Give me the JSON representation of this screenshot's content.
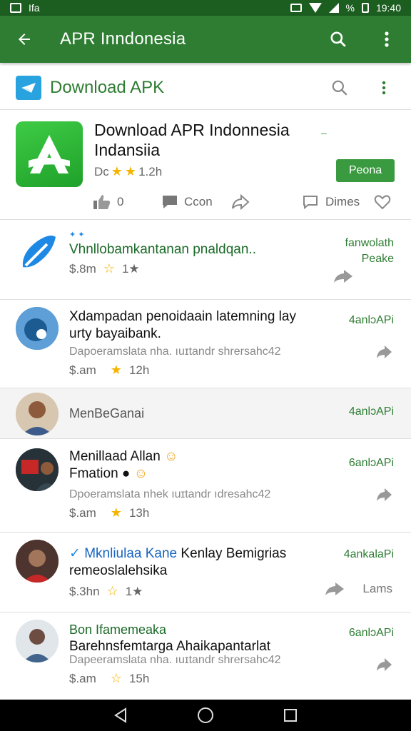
{
  "status_bar": {
    "app_icon": "image-icon",
    "indicator": "Ifa",
    "percent": "%",
    "time": "19:40"
  },
  "app_bar": {
    "title": "APR Inndonesia",
    "back_icon": "arrow-left-icon",
    "search_icon": "search-icon",
    "more_icon": "more-vertical-icon"
  },
  "sub_bar": {
    "title": "Download APK",
    "logo_icon": "plane-icon"
  },
  "hero": {
    "title_line1": "Download APR Indonnesia",
    "title_line2": "Indansiia",
    "dash": "–",
    "rating_prefix": "Dc",
    "stars_filled": 2,
    "rating_count": "1.2h",
    "open_label": "Peona",
    "actions": {
      "like_count": "0",
      "comment_label": "Ccon",
      "share_label": "",
      "dimes_label": "Dimes"
    }
  },
  "items": [
    {
      "title": "Vhnllobamkantanan pnaldqan..",
      "meta_left": "$.8m",
      "meta_extra": "1★",
      "right_line1": "fanwolath",
      "right_line2": "Peake",
      "share_label": ""
    },
    {
      "title": "Xdampadan penoidaain latemning lay urty bayaibank.",
      "sub": "Dapoeramslata nha. ıuɪtandr shrersahc42",
      "meta_left": "$.am",
      "time": "12h",
      "right_line1": "4anlɔAPi"
    },
    {
      "section_label": "MenBeGanai",
      "right_line1": "4anlɔAPi"
    },
    {
      "title_line1": "Menillaad Allan",
      "title_line2": "Fmation",
      "sub": "Dpoeramslata nhek ıuɪtandr ıdresahc42",
      "meta_left": "$.am",
      "time": "13h",
      "right_line1": "6anlɔAPi"
    },
    {
      "title_prefix": "Mknliulaa Kane",
      "title_rest": "Kenlay Bemigrias",
      "title_line2": "remeoslalehsika",
      "meta_left": "$.3hn",
      "meta_extra": "1★",
      "right_line1": "4ankalaPi",
      "share_label": "Lams"
    },
    {
      "title_line1": "Bon Ifamemeaka",
      "title_line2": "Barehnsfemtarga Ahaikapantarlat",
      "sub": "Dapeeramslata nha. ıuɪtandr shrersahc42",
      "meta_left": "$.am",
      "time": "15h",
      "right_line1": "6anlɔAPi"
    }
  ],
  "colors": {
    "primary": "#2e7d32",
    "primary_dark": "#1b5e20",
    "accent": "#3a9a3f",
    "star": "#f5b400"
  }
}
